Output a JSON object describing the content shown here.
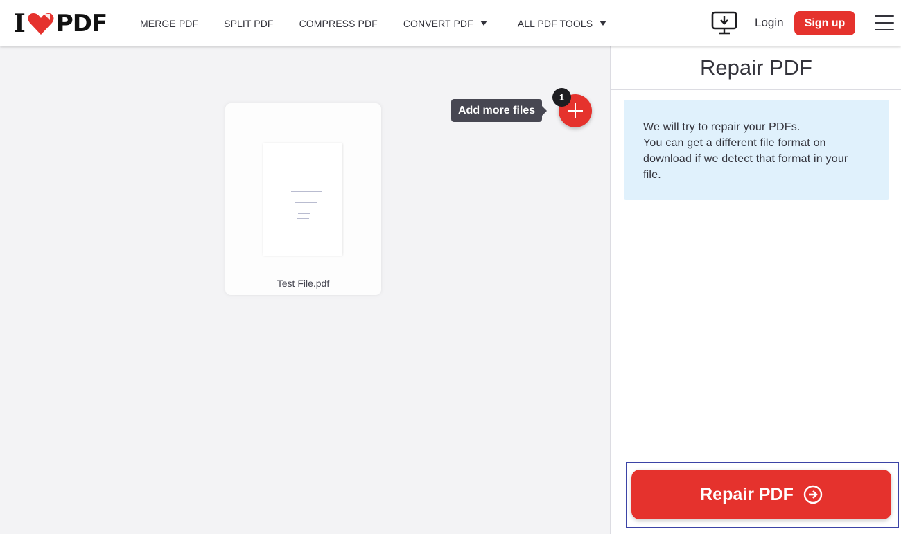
{
  "header": {
    "logo": {
      "prefix": "I",
      "suffix": "PDF",
      "heart_color": "#e5322d"
    },
    "nav": [
      {
        "label": "MERGE PDF",
        "dropdown": false
      },
      {
        "label": "SPLIT PDF",
        "dropdown": false
      },
      {
        "label": "COMPRESS PDF",
        "dropdown": false
      },
      {
        "label": "CONVERT PDF",
        "dropdown": true
      },
      {
        "label": "ALL PDF TOOLS",
        "dropdown": true
      }
    ],
    "desktop_icon": "desktop-download-icon",
    "login_label": "Login",
    "signup_label": "Sign up",
    "menu_icon": "hamburger-menu-icon"
  },
  "workspace": {
    "file": {
      "name": "Test File.pdf"
    },
    "add_more": {
      "label": "Add more files",
      "count": "1",
      "icon": "plus-icon"
    }
  },
  "sidebar": {
    "title": "Repair PDF",
    "info_lines": [
      "We will try to repair your PDFs.",
      "You can get a different file format on",
      "download if we detect that format in your",
      "file."
    ],
    "action_label": "Repair PDF",
    "action_icon": "arrow-right-circle-icon"
  },
  "colors": {
    "brand_red": "#e5322d",
    "info_bg": "#e0f1fc",
    "focus_outline": "#3c44a6",
    "tooltip_bg": "#474752"
  }
}
